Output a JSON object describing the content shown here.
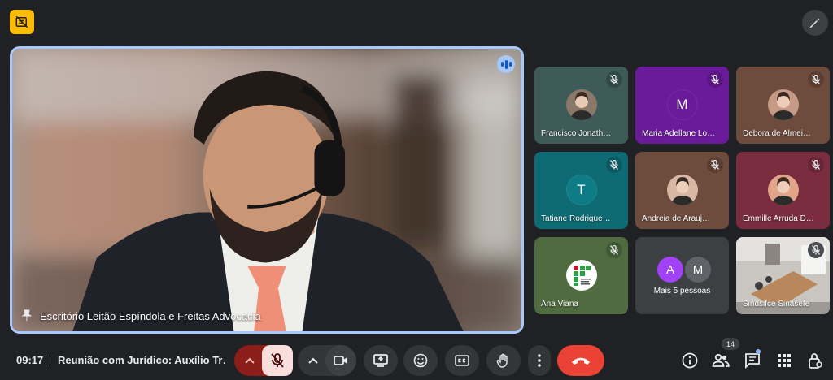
{
  "main": {
    "name": "Escritório Leitão Espíndola e Freitas Advocacia"
  },
  "tiles": [
    {
      "name": "Francisco Jonath…",
      "bg": "#3f5b59",
      "mic_bg": "#2f4a49",
      "type": "photo",
      "photo_color": "#8a7868"
    },
    {
      "name": "Maria Adellane Lo…",
      "bg": "#6a1b9a",
      "mic_bg": "#5a1583",
      "type": "initial",
      "initial": "M",
      "avatar_bg": "#6a1b9a"
    },
    {
      "name": "Debora de Almei…",
      "bg": "#6d4c3d",
      "mic_bg": "#5b3e31",
      "type": "photo",
      "photo_color": "#c79a86"
    },
    {
      "name": "Tatiane Rodrigue…",
      "bg": "#0e6b73",
      "mic_bg": "#0b5a61",
      "type": "initial",
      "initial": "T",
      "avatar_bg": "#0e7c86"
    },
    {
      "name": "Andreia de Arauj…",
      "bg": "#6d4c3d",
      "mic_bg": "#5b3e31",
      "type": "photo",
      "photo_color": "#d8b7a4"
    },
    {
      "name": "Emmille Arruda D…",
      "bg": "#7b2d3f",
      "mic_bg": "#672535",
      "type": "photo",
      "photo_color": "#e3a58a"
    },
    {
      "name": "Ana Viana",
      "bg": "#4f6b3f",
      "mic_bg": "#405833",
      "type": "logo"
    },
    {
      "name": "",
      "bg": "#3c4043",
      "type": "more",
      "label": "Mais 5 pessoas",
      "initials": [
        "A",
        "M"
      ],
      "initial_colors": [
        "#a142f4",
        "#5f6368"
      ]
    },
    {
      "name": "Sindsifce Sinasefe",
      "bg": "#5f6368",
      "mic_bg": "#4a4d50",
      "type": "room"
    }
  ],
  "bottom": {
    "time": "09:17",
    "meeting_title": "Reunião com Jurídico: Auxílio Tr…",
    "participant_count": "14"
  },
  "colors": {
    "accent": "#a8c7fa",
    "mic_off": "#f9dedc",
    "end_call": "#ea4335",
    "badge": "#fbbc04"
  }
}
